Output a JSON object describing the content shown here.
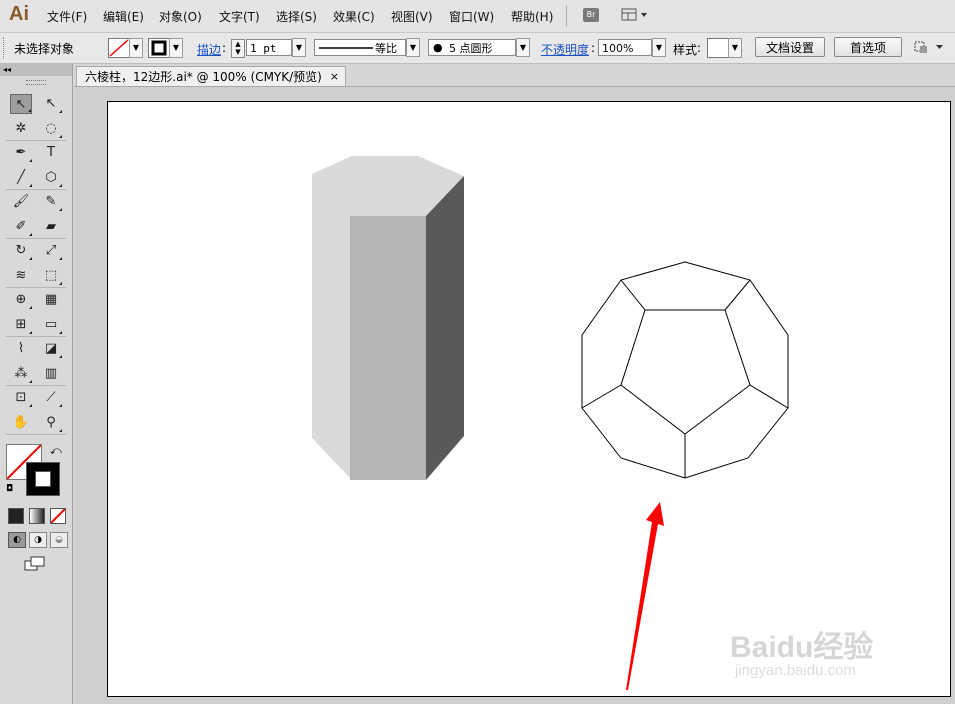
{
  "app": {
    "logo": "Ai"
  },
  "menu": [
    {
      "label": "文件(F)"
    },
    {
      "label": "编辑(E)"
    },
    {
      "label": "对象(O)"
    },
    {
      "label": "文字(T)"
    },
    {
      "label": "选择(S)"
    },
    {
      "label": "效果(C)"
    },
    {
      "label": "视图(V)"
    },
    {
      "label": "窗口(W)"
    },
    {
      "label": "帮助(H)"
    }
  ],
  "menubar_buttons": {
    "bridge": "Br"
  },
  "control": {
    "selection_status": "未选择对象",
    "stroke_link": "描边",
    "stroke_weight": "1 pt",
    "stroke_profile": "等比",
    "brush": "5 点圆形",
    "opacity_link": "不透明度",
    "opacity_value": "100%",
    "style_label": "样式",
    "doc_setup_button": "文档设置",
    "prefs_button": "首选项"
  },
  "document_tab": {
    "title": "六棱柱，12边形.ai* @ 100% (CMYK/预览)",
    "close": "×"
  },
  "tools": [
    {
      "name": "selection-tool-icon",
      "glyph": "↖"
    },
    {
      "name": "direct-selection-tool-icon",
      "glyph": "↖"
    },
    {
      "name": "magic-wand-tool-icon",
      "glyph": "✲"
    },
    {
      "name": "lasso-tool-icon",
      "glyph": "◌"
    },
    {
      "name": "pen-tool-icon",
      "glyph": "✒"
    },
    {
      "name": "type-tool-icon",
      "glyph": "T"
    },
    {
      "name": "line-tool-icon",
      "glyph": "╱"
    },
    {
      "name": "polygon-tool-icon",
      "glyph": "⬡"
    },
    {
      "name": "paintbrush-tool-icon",
      "glyph": "🖌"
    },
    {
      "name": "pencil-tool-icon",
      "glyph": "✎"
    },
    {
      "name": "blob-brush-tool-icon",
      "glyph": "✐"
    },
    {
      "name": "eraser-tool-icon",
      "glyph": "▰"
    },
    {
      "name": "rotate-tool-icon",
      "glyph": "↻"
    },
    {
      "name": "scale-tool-icon",
      "glyph": "⤢"
    },
    {
      "name": "warp-tool-icon",
      "glyph": "≋"
    },
    {
      "name": "free-transform-tool-icon",
      "glyph": "⬚"
    },
    {
      "name": "shape-builder-tool-icon",
      "glyph": "⊕"
    },
    {
      "name": "perspective-grid-tool-icon",
      "glyph": "▦"
    },
    {
      "name": "mesh-tool-icon",
      "glyph": "⊞"
    },
    {
      "name": "gradient-tool-icon",
      "glyph": "▭"
    },
    {
      "name": "eyedropper-tool-icon",
      "glyph": "⌇"
    },
    {
      "name": "blend-tool-icon",
      "glyph": "◪"
    },
    {
      "name": "symbol-sprayer-tool-icon",
      "glyph": "⁂"
    },
    {
      "name": "column-graph-tool-icon",
      "glyph": "▥"
    },
    {
      "name": "artboard-tool-icon",
      "glyph": "⊡"
    },
    {
      "name": "slice-tool-icon",
      "glyph": "⟋"
    },
    {
      "name": "hand-tool-icon",
      "glyph": "✋"
    },
    {
      "name": "zoom-tool-icon",
      "glyph": "⚲"
    }
  ],
  "colors": {
    "prism_top": "#d9dbd8",
    "prism_left": "#d9dbd8",
    "prism_front": "#b4b5b4",
    "prism_right": "#5a595a",
    "arrow": "#ff0000"
  },
  "watermark": {
    "brand": "Baidu经验",
    "url": "jingyan.baidu.com"
  }
}
